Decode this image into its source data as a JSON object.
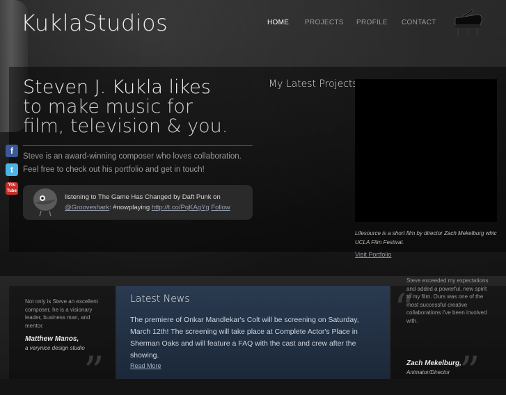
{
  "header": {
    "logo": "KuklaStudios"
  },
  "nav": {
    "items": [
      {
        "label": "HOME",
        "active": true
      },
      {
        "label": "PROJECTS",
        "active": false
      },
      {
        "label": "PROFILE",
        "active": false
      },
      {
        "label": "CONTACT",
        "active": false
      }
    ]
  },
  "hero": {
    "headline_line1": "Steven J. Kukla likes",
    "headline_line2": "to make music for",
    "headline_line3": "film, television & you.",
    "intro": "Steve is an award-winning composer who loves collaboration. Feel free to check out his portfolio and get in touch!"
  },
  "social": [
    {
      "icon": "facebook-icon",
      "label": "f"
    },
    {
      "icon": "twitter-icon",
      "label": "t"
    },
    {
      "icon": "youtube-icon",
      "label": "You Tube"
    }
  ],
  "tweet": {
    "prefix": "listening to The Game Has Changed by Daft Punk on",
    "grooveshark": "@Grooveshark",
    "hashtag": ": #nowplaying",
    "link": "http://t.co/PqKAgYg",
    "follow": "Follow"
  },
  "projects": {
    "title": "My Latest Projects",
    "caption": "Lifesource is a short film by director Zach Mekelburg whic UCLA Film Festival.",
    "caption_line1": "Lifesource is a short film by director Zach Mekelburg whic",
    "caption_line2": "UCLA Film Festival.",
    "visit": "Visit Portfolio"
  },
  "quote_left": {
    "text": "Not only is Steve an excellent composer, he is a visionary leader, business man, and mentor.",
    "name": "Matthew Manos,",
    "role": "a verynice design studio"
  },
  "news": {
    "title": "Latest News",
    "body": "The premiere of Onkar Mandlekar's Colt will be screening on Saturday, March 12th!  The screening will take place at Complete Actor's Place in Sherman Oaks and will feature a FAQ with the cast and crew after the showing.",
    "read_more": "Read More"
  },
  "quote_right": {
    "text": "Steve exceeded my expectations and added a powerful, new spirit to my film. Ours was one of the most successful creative collaborations I've been involved with.",
    "name": "Zach Mekelburg,",
    "role": "Animator/Director"
  },
  "colors": {
    "background": "#141414",
    "news_panel": "#2a3a50",
    "link": "#9aa4b4"
  }
}
